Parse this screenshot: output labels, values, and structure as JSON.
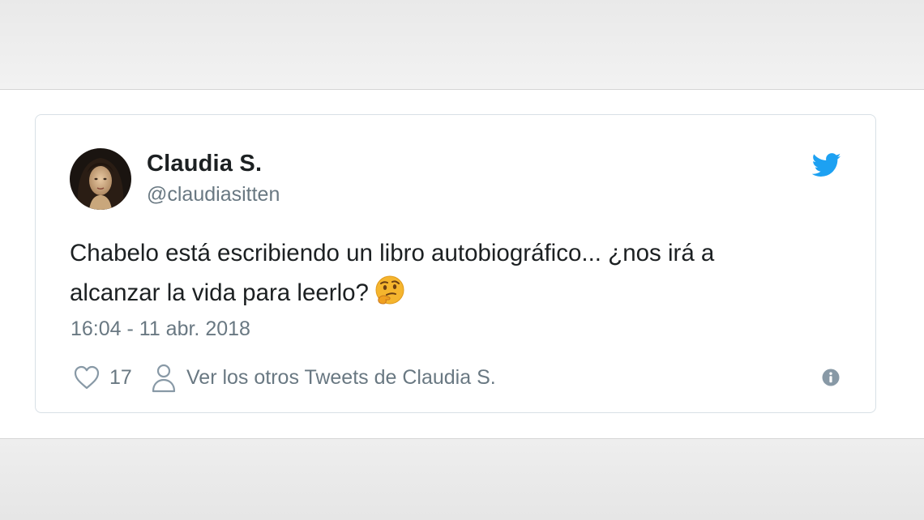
{
  "tweet": {
    "display_name": "Claudia S.",
    "handle": "@claudiasitten",
    "text_line_1": "Chabelo está escribiendo un libro autobiográfico... ¿nos irá a",
    "text_line_2": "alcanzar la vida para leerlo?",
    "emoji": "thinking-face",
    "timestamp": "16:04 - 11 abr. 2018",
    "like_count": "17",
    "more_tweets_label": "Ver los otros Tweets de Claudia S."
  },
  "icons": {
    "brand": "twitter-bird-icon",
    "like": "heart-icon",
    "profile": "person-icon",
    "info": "info-icon"
  },
  "colors": {
    "twitter_blue": "#1da1f2",
    "text_primary": "#1c2022",
    "text_secondary": "#697882",
    "card_border": "#d8e0e6",
    "icon_gray": "#8899a6"
  }
}
